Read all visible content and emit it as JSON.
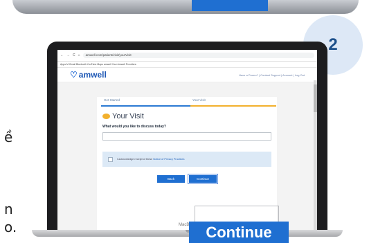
{
  "step": {
    "number": "2"
  },
  "side_text": {
    "line1": "ề",
    "line2": "n",
    "line3": "o."
  },
  "browser": {
    "nav_icons": [
      "←",
      "→",
      "C",
      "⌂"
    ],
    "url": "amwell.com/patient/visit/yourVisit",
    "bookmarks": "Apps  M Gmail  Bluetooth  YouTube  Maps  amwell  Your Amwell  Providers"
  },
  "site": {
    "logo_text": "amwell",
    "header_links": "Have a Promo? | Contact Support | Account | Log Out"
  },
  "form": {
    "step_left": "Get Started",
    "step_right": "Your Visit",
    "title": "Your Visit",
    "question": "What would you like to discuss today?",
    "input_value": "",
    "privacy_text": "I acknowledge receipt of these ",
    "privacy_link": "Notice of Privacy Practices",
    "back_label": "Back",
    "continue_label": "Continue"
  },
  "laptop_label": "MacBook",
  "callout": {
    "label": "Continue"
  },
  "colors": {
    "brand_blue": "#1f6fd1",
    "progress_orange": "#f2b02d",
    "step_circle": "#dde8f6"
  }
}
